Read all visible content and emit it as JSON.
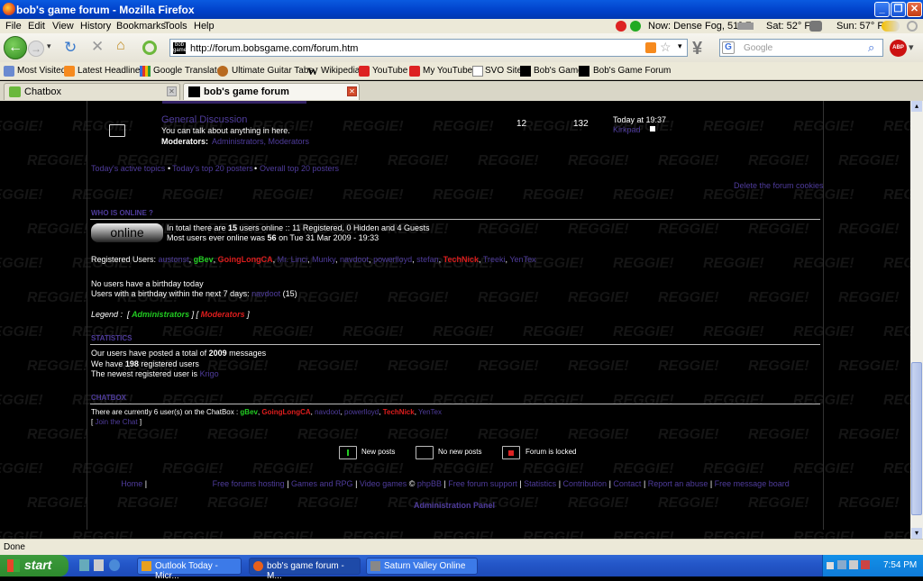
{
  "window": {
    "title": "bob's game forum - Mozilla Firefox"
  },
  "menu": [
    "File",
    "Edit",
    "View",
    "History",
    "Bookmarks",
    "Tools",
    "Help"
  ],
  "weather": {
    "now": "Now: Dense Fog, 51° F",
    "sat": "Sat: 52° F",
    "sun": "Sun: 57° F"
  },
  "nav": {
    "url": "http://forum.bobsgame.com/forum.htm",
    "search_placeholder": "Google"
  },
  "bookmarks": [
    "Most Visited",
    "Latest Headlines",
    "Google Translate",
    "Ultimate Guitar Tabs",
    "Wikipedia",
    "YouTube",
    "My YouTube",
    "SVO Site",
    "Bob's Game",
    "Bob's Game Forum"
  ],
  "tabs": [
    {
      "label": "Chatbox"
    },
    {
      "label": "bob's game forum"
    }
  ],
  "forum": {
    "row": {
      "title": "General Discussion",
      "desc": "You can talk about anything in here.",
      "mods_label": "Moderators:",
      "mods": "Administrators, Moderators",
      "topics": "12",
      "posts": "132",
      "last_time": "Today at 19:37",
      "last_user": "Kirkpad"
    },
    "links_row": {
      "a": "Today's active topics",
      "b": "Today's top 20 posters",
      "c": "Overall top 20 posters"
    },
    "delete_cookies": "Delete the forum cookies",
    "who_header": "WHO IS ONLINE ?",
    "online_badge": "online",
    "online_line1_pre": "In total there are ",
    "online_count": "15",
    "online_line1_post": " users online :: 11 Registered, 0 Hidden and 4 Guests",
    "online_line2_pre": "Most users ever online was ",
    "online_max": "56",
    "online_line2_post": " on Tue 31 Mar 2009 - 19:33",
    "registered_label": "Registered Users:",
    "users": [
      {
        "name": "austonst",
        "color": "#4f3c9c"
      },
      {
        "name": "gBev",
        "color": "#22cc22"
      },
      {
        "name": "GoingLongCA",
        "color": "#dd1d1d"
      },
      {
        "name": "Mr. Linci",
        "color": "#4f3c9c"
      },
      {
        "name": "Munky",
        "color": "#4f3c9c"
      },
      {
        "name": "navdoot",
        "color": "#4f3c9c"
      },
      {
        "name": "powerlloyd",
        "color": "#4f3c9c"
      },
      {
        "name": "stefan",
        "color": "#4f3c9c"
      },
      {
        "name": "TechNick",
        "color": "#dd1d1d"
      },
      {
        "name": "Treeki",
        "color": "#4f3c9c"
      },
      {
        "name": "YenTex",
        "color": "#4f3c9c"
      }
    ],
    "birthday_today": "No users have a birthday today",
    "birthday_next": "Users with a birthday within the next 7 days: ",
    "birthday_user": "navdoot",
    "birthday_age": " (15)",
    "legend_label": "Legend :",
    "legend_admin": "Administrators",
    "legend_mod": "Moderators",
    "stats_header": "STATISTICS",
    "stats_line1_pre": "Our users have posted a total of ",
    "stats_msgs": "2009",
    "stats_line1_post": " messages",
    "stats_line2_pre": "We have ",
    "stats_users": "198",
    "stats_line2_post": " registered users",
    "stats_line3": "The newest registered user is ",
    "stats_newest": "Krigo",
    "chat_header": "CHATBOX",
    "chat_line_pre": "There are currently 6 user(s) on the ChatBox : ",
    "chat_users": [
      {
        "name": "gBev",
        "color": "#22cc22"
      },
      {
        "name": "GoingLongCA",
        "color": "#dd1d1d"
      },
      {
        "name": "navdoot",
        "color": "#4f3c9c"
      },
      {
        "name": "powerlloyd",
        "color": "#4f3c9c"
      },
      {
        "name": "TechNick",
        "color": "#dd1d1d"
      },
      {
        "name": "YenTex",
        "color": "#4f3c9c"
      }
    ],
    "join_chat": "Join the Chat",
    "icons_legend": {
      "new": "New posts",
      "nonew": "No new posts",
      "locked": "Forum is locked"
    },
    "footer": [
      "Home",
      "Free forums hosting",
      "Games and RPG",
      "Video games",
      "phpBB",
      "Free forum support",
      "Statistics",
      "Contribution",
      "Contact",
      "Report an abuse",
      "Free message board"
    ],
    "admin_panel": "Administration Panel",
    "watermark": "REGGIE!"
  },
  "status": "Done",
  "taskbar": {
    "start": "start",
    "buttons": [
      "Outlook Today - Micr...",
      "bob's game forum - M...",
      "Saturn Valley Online"
    ],
    "clock": "7:54 PM"
  }
}
